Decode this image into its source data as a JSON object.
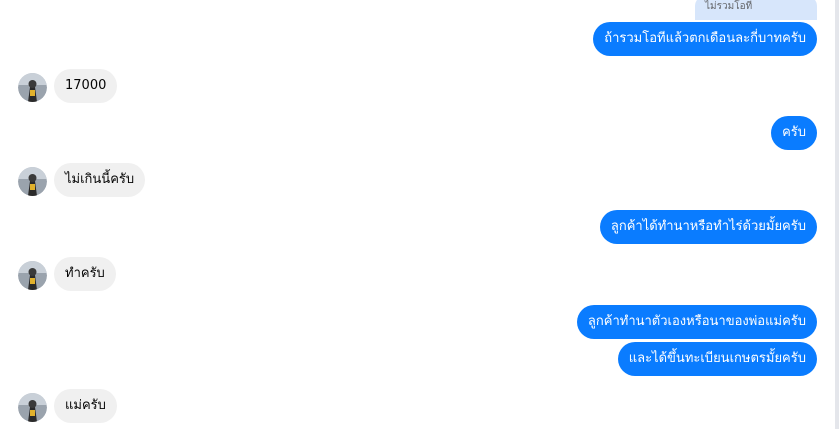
{
  "conversation": {
    "reply_quote": "ไม่รวมโอที",
    "messages": [
      {
        "side": "out",
        "text": "ถ้ารวมโอทีแล้วตกเดือนละกี่บาทครับ"
      },
      {
        "side": "in",
        "text": "17000"
      },
      {
        "side": "out",
        "text": "ครับ"
      },
      {
        "side": "in",
        "text": "ไม่เกินนี้ครับ"
      },
      {
        "side": "out",
        "text": "ลูกค้าได้ทำนาหรือทำไร่ด้วยมั้ยครับ"
      },
      {
        "side": "in",
        "text": "ทำครับ"
      },
      {
        "side": "out",
        "text": "ลูกค้าทำนาตัวเองหรือนาของพ่อแม่ครับ"
      },
      {
        "side": "out",
        "text": "และได้ขึ้นทะเบียนเกษตรมั้ยครับ"
      },
      {
        "side": "in",
        "text": "แม่ครับ"
      }
    ]
  },
  "colors": {
    "outgoing_bubble": "#0a7cff",
    "incoming_bubble": "#f0f0f0",
    "reply_quote_bg": "#d7e6fb"
  },
  "icons": {
    "avatar": "contact-avatar"
  }
}
